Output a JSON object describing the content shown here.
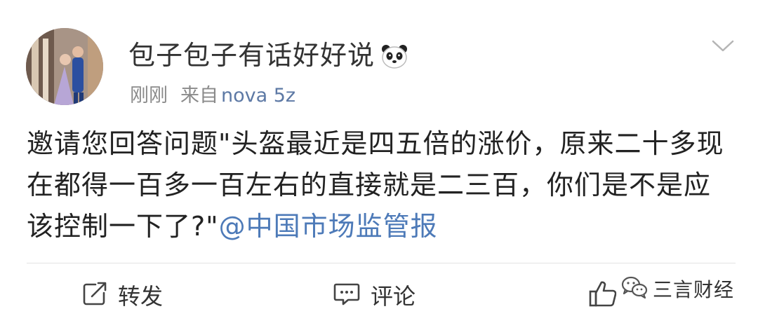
{
  "post": {
    "author": "包子包子有话好好说",
    "author_emoji": "panda-emoji",
    "time": "刚刚",
    "source_prefix": "来自",
    "source_device": "nova 5z",
    "text": "邀请您回答问题\"头盔最近是四五倍的涨价，原来二十多现在都得一百多一百左右的直接就是二三百，你们是不是应该控制一下了?\"",
    "mention": "@中国市场监管报"
  },
  "actions": {
    "repost": "转发",
    "comment": "评论",
    "like": ""
  },
  "watermark": {
    "text": "三言财经",
    "icon": "wechat-icon"
  },
  "colors": {
    "mention": "#4d7ab8",
    "device": "#5d79a5",
    "meta": "#8a8a8a",
    "text": "#222222"
  }
}
